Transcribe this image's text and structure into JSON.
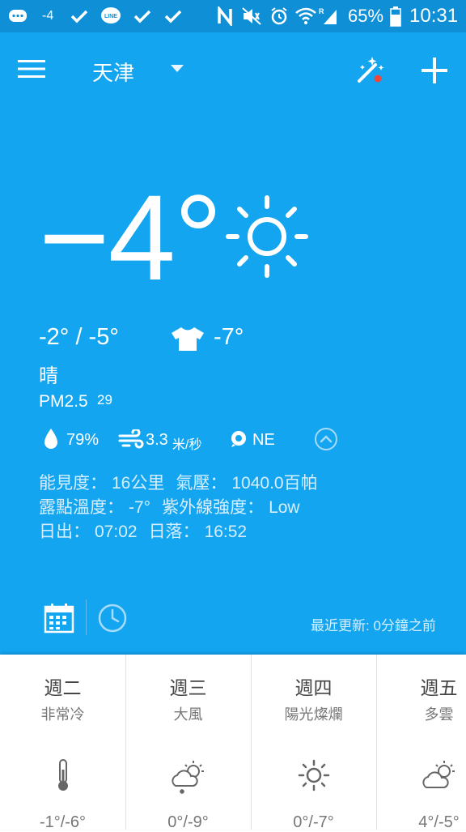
{
  "status_bar": {
    "temp_notification": "-4",
    "battery": "65%",
    "time": "10:31",
    "icons": [
      "chat-bubble-icon",
      "check-icon",
      "line-app-icon",
      "check-icon",
      "check-icon",
      "nfc-icon",
      "mute-icon",
      "alarm-icon",
      "wifi-icon",
      "signal-icon",
      "battery-icon"
    ]
  },
  "topbar": {
    "city": "天津",
    "menu_icon": "hamburger-menu-icon",
    "theme_icon": "magic-wand-icon",
    "add_icon": "plus-icon"
  },
  "current": {
    "temperature": "−4°",
    "condition_icon": "sun-icon",
    "high_low": "-2° / -5°",
    "feels_like": "-7°",
    "condition": "晴",
    "pm25_label": "PM2.5",
    "pm25_value": "29",
    "humidity": "79%",
    "wind_speed": "3.3",
    "wind_unit": "米/秒",
    "wind_direction": "NE"
  },
  "details": {
    "visibility_label": "能見度：",
    "visibility_value": "16公里",
    "pressure_label": "氣壓：",
    "pressure_value": "1040.0百帕",
    "dewpoint_label": "露點溫度：",
    "dewpoint_value": "-7°",
    "uv_label": "紫外線強度：",
    "uv_value": "Low",
    "sunrise_label": "日出：",
    "sunrise_value": "07:02",
    "sunset_label": "日落：",
    "sunset_value": "16:52"
  },
  "footer": {
    "updated": "最近更新: 0分鐘之前"
  },
  "forecast": [
    {
      "day": "週二",
      "condition": "非常冷",
      "icon": "thermometer-icon",
      "range": "-1°/-6°"
    },
    {
      "day": "週三",
      "condition": "大風",
      "icon": "snow-cloud-sun-icon",
      "range": "0°/-9°"
    },
    {
      "day": "週四",
      "condition": "陽光燦爛",
      "icon": "sun-icon",
      "range": "0°/-7°"
    },
    {
      "day": "週五",
      "condition": "多雲",
      "icon": "cloud-sun-icon",
      "range": "4°/-5°"
    }
  ],
  "colors": {
    "status_bar": "#0f8fd6",
    "primary": "#13a5f0",
    "accent_dot": "#f0463c"
  }
}
